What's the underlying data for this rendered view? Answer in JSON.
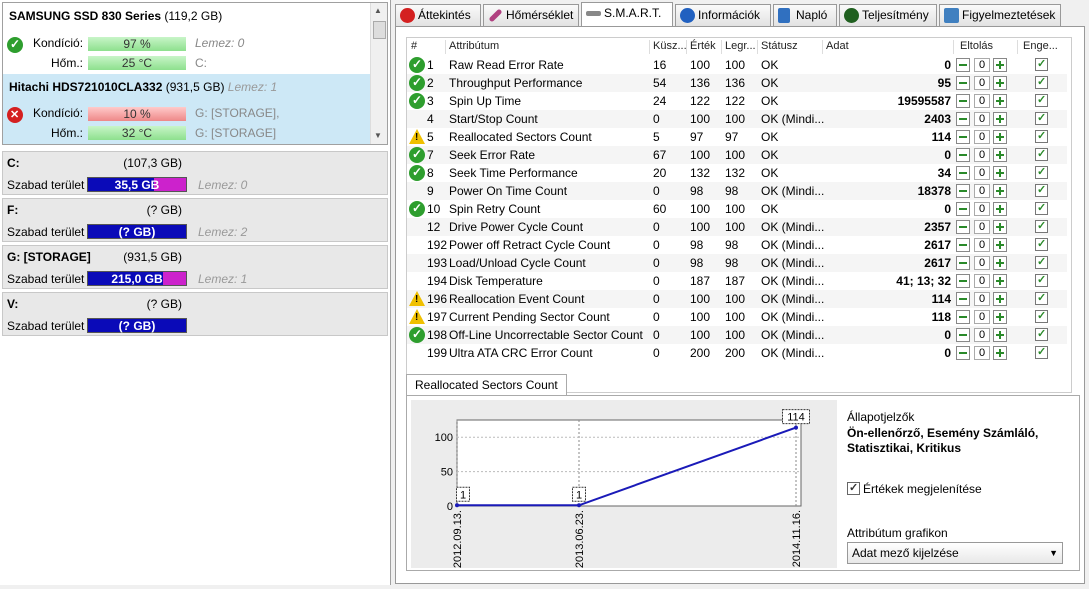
{
  "drives": [
    {
      "name": "SAMSUNG SSD 830 Series",
      "size": "(119,2 GB)",
      "status": "ok",
      "health_label": "Kondíció:",
      "health_value": "97 %",
      "health_pct": 97,
      "temp_label": "Hőm.:",
      "temp_value": "25 °C",
      "side1": "Lemez: 0",
      "side2": "C:"
    },
    {
      "name": "Hitachi HDS721010CLA332",
      "size": "(931,5 GB)",
      "disk_label": "Lemez: 1",
      "status": "bad",
      "health_label": "Kondíció:",
      "health_value": "10 %",
      "health_pct": 10,
      "temp_label": "Hőm.:",
      "temp_value": "32 °C",
      "side1": "G: [STORAGE],",
      "side2": "G: [STORAGE]"
    }
  ],
  "volumes": [
    {
      "label": "C:",
      "size": "(107,3 GB)",
      "free_label": "Szabad terület",
      "free": "35,5 GB",
      "used_fraction": 0.33,
      "disk": "Lemez: 0"
    },
    {
      "label": "F:",
      "size": "(? GB)",
      "free_label": "Szabad terület",
      "free": "(? GB)",
      "used_fraction": 0,
      "disk": "Lemez: 2"
    },
    {
      "label": "G: [STORAGE]",
      "size": "(931,5 GB)",
      "free_label": "Szabad terület",
      "free": "215,0 GB",
      "used_fraction": 0.23,
      "disk": "Lemez: 1"
    },
    {
      "label": "V:",
      "size": "(? GB)",
      "free_label": "Szabad terület",
      "free": "(? GB)",
      "used_fraction": 0,
      "disk": ""
    }
  ],
  "tabs": [
    {
      "label": "Áttekintés",
      "icon": "error-circle-icon",
      "color": "#d42020",
      "active": false
    },
    {
      "label": "Hőmérséklet",
      "icon": "thermometer-icon",
      "color": "#b04080",
      "active": false
    },
    {
      "label": "S.M.A.R.T.",
      "icon": "wrench-icon",
      "color": "#888888",
      "active": true
    },
    {
      "label": "Információk",
      "icon": "info-icon",
      "color": "#2060c0",
      "active": false
    },
    {
      "label": "Napló",
      "icon": "log-icon",
      "color": "#3070c0",
      "active": false
    },
    {
      "label": "Teljesítmény",
      "icon": "speedometer-icon",
      "color": "#206020",
      "active": false
    },
    {
      "label": "Figyelmeztetések",
      "icon": "alerts-icon",
      "color": "#4080c0",
      "active": false
    }
  ],
  "smart_headers": [
    "#",
    "Attribútum",
    "Küsz...",
    "Érték",
    "Legr...",
    "Státusz",
    "Adat",
    "Eltolás",
    "Enge..."
  ],
  "smart_rows": [
    {
      "icon": "ok",
      "id": "1",
      "name": "Raw Read Error Rate",
      "thr": "16",
      "val": "100",
      "worst": "100",
      "status": "OK",
      "data": "0",
      "offset": "0"
    },
    {
      "icon": "ok",
      "id": "2",
      "name": "Throughput Performance",
      "thr": "54",
      "val": "136",
      "worst": "136",
      "status": "OK",
      "data": "95",
      "offset": "0"
    },
    {
      "icon": "ok",
      "id": "3",
      "name": "Spin Up Time",
      "thr": "24",
      "val": "122",
      "worst": "122",
      "status": "OK",
      "data": "19595587",
      "offset": "0"
    },
    {
      "icon": "",
      "id": "4",
      "name": "Start/Stop Count",
      "thr": "0",
      "val": "100",
      "worst": "100",
      "status": "OK (Mindi...",
      "data": "2403",
      "offset": "0"
    },
    {
      "icon": "warn",
      "id": "5",
      "name": "Reallocated Sectors Count",
      "thr": "5",
      "val": "97",
      "worst": "97",
      "status": "OK",
      "data": "114",
      "offset": "0"
    },
    {
      "icon": "ok",
      "id": "7",
      "name": "Seek Error Rate",
      "thr": "67",
      "val": "100",
      "worst": "100",
      "status": "OK",
      "data": "0",
      "offset": "0"
    },
    {
      "icon": "ok",
      "id": "8",
      "name": "Seek Time Performance",
      "thr": "20",
      "val": "132",
      "worst": "132",
      "status": "OK",
      "data": "34",
      "offset": "0"
    },
    {
      "icon": "",
      "id": "9",
      "name": "Power On Time Count",
      "thr": "0",
      "val": "98",
      "worst": "98",
      "status": "OK (Mindi...",
      "data": "18378",
      "offset": "0"
    },
    {
      "icon": "ok",
      "id": "10",
      "name": "Spin Retry Count",
      "thr": "60",
      "val": "100",
      "worst": "100",
      "status": "OK",
      "data": "0",
      "offset": "0"
    },
    {
      "icon": "",
      "id": "12",
      "name": "Drive Power Cycle Count",
      "thr": "0",
      "val": "100",
      "worst": "100",
      "status": "OK (Mindi...",
      "data": "2357",
      "offset": "0"
    },
    {
      "icon": "",
      "id": "192",
      "name": "Power off Retract Cycle Count",
      "thr": "0",
      "val": "98",
      "worst": "98",
      "status": "OK (Mindi...",
      "data": "2617",
      "offset": "0"
    },
    {
      "icon": "",
      "id": "193",
      "name": "Load/Unload Cycle Count",
      "thr": "0",
      "val": "98",
      "worst": "98",
      "status": "OK (Mindi...",
      "data": "2617",
      "offset": "0"
    },
    {
      "icon": "",
      "id": "194",
      "name": "Disk Temperature",
      "thr": "0",
      "val": "187",
      "worst": "187",
      "status": "OK (Mindi...",
      "data": "41; 13; 32",
      "offset": "0"
    },
    {
      "icon": "warn",
      "id": "196",
      "name": "Reallocation Event Count",
      "thr": "0",
      "val": "100",
      "worst": "100",
      "status": "OK (Mindi...",
      "data": "114",
      "offset": "0"
    },
    {
      "icon": "warn",
      "id": "197",
      "name": "Current Pending Sector Count",
      "thr": "0",
      "val": "100",
      "worst": "100",
      "status": "OK (Mindi...",
      "data": "118",
      "offset": "0"
    },
    {
      "icon": "ok",
      "id": "198",
      "name": "Off-Line Uncorrectable Sector Count",
      "thr": "0",
      "val": "100",
      "worst": "100",
      "status": "OK (Mindi...",
      "data": "0",
      "offset": "0"
    },
    {
      "icon": "",
      "id": "199",
      "name": "Ultra ATA CRC Error Count",
      "thr": "0",
      "val": "200",
      "worst": "200",
      "status": "OK (Mindi...",
      "data": "0",
      "offset": "0"
    }
  ],
  "graph": {
    "tab_label": "Reallocated Sectors Count",
    "status_title": "Állapotjelzők",
    "status_bold": "Ön-ellenőrző, Esemény Számláló, Statisztikai, Kritikus",
    "show_values_label": "Értékek megjelenítése",
    "attr_graph_label": "Attribútum grafikon",
    "dropdown_value": "Adat mező kijelzése"
  },
  "chart_data": {
    "type": "line",
    "x": [
      "2012.09.13.",
      "2013.06.23.",
      "2014.11.16."
    ],
    "values": [
      1,
      1,
      114
    ],
    "point_labels": [
      "1",
      "1",
      "114"
    ],
    "yticks": [
      "0",
      "50",
      "100"
    ],
    "ylim": [
      0,
      125
    ],
    "grid": true,
    "line_color": "#1a1ab8"
  }
}
